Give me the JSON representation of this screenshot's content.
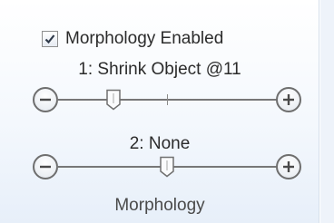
{
  "group": {
    "title": "Morphology",
    "checkbox": {
      "label": "Morphology Enabled",
      "checked": true
    },
    "sliders": [
      {
        "label": "1: Shrink Object @11",
        "value_fraction": 0.27,
        "tick_fraction": 0.5
      },
      {
        "label": "2: None",
        "value_fraction": 0.5
      }
    ]
  },
  "icons": {
    "checkbox": "checkmark-icon",
    "decrease": "minus-icon",
    "increase": "plus-icon",
    "thumb": "slider-thumb-icon"
  },
  "colors": {
    "panel_background": "#f4f8fd",
    "text": "#2b2b2b",
    "control_border": "#6e6e6e"
  }
}
